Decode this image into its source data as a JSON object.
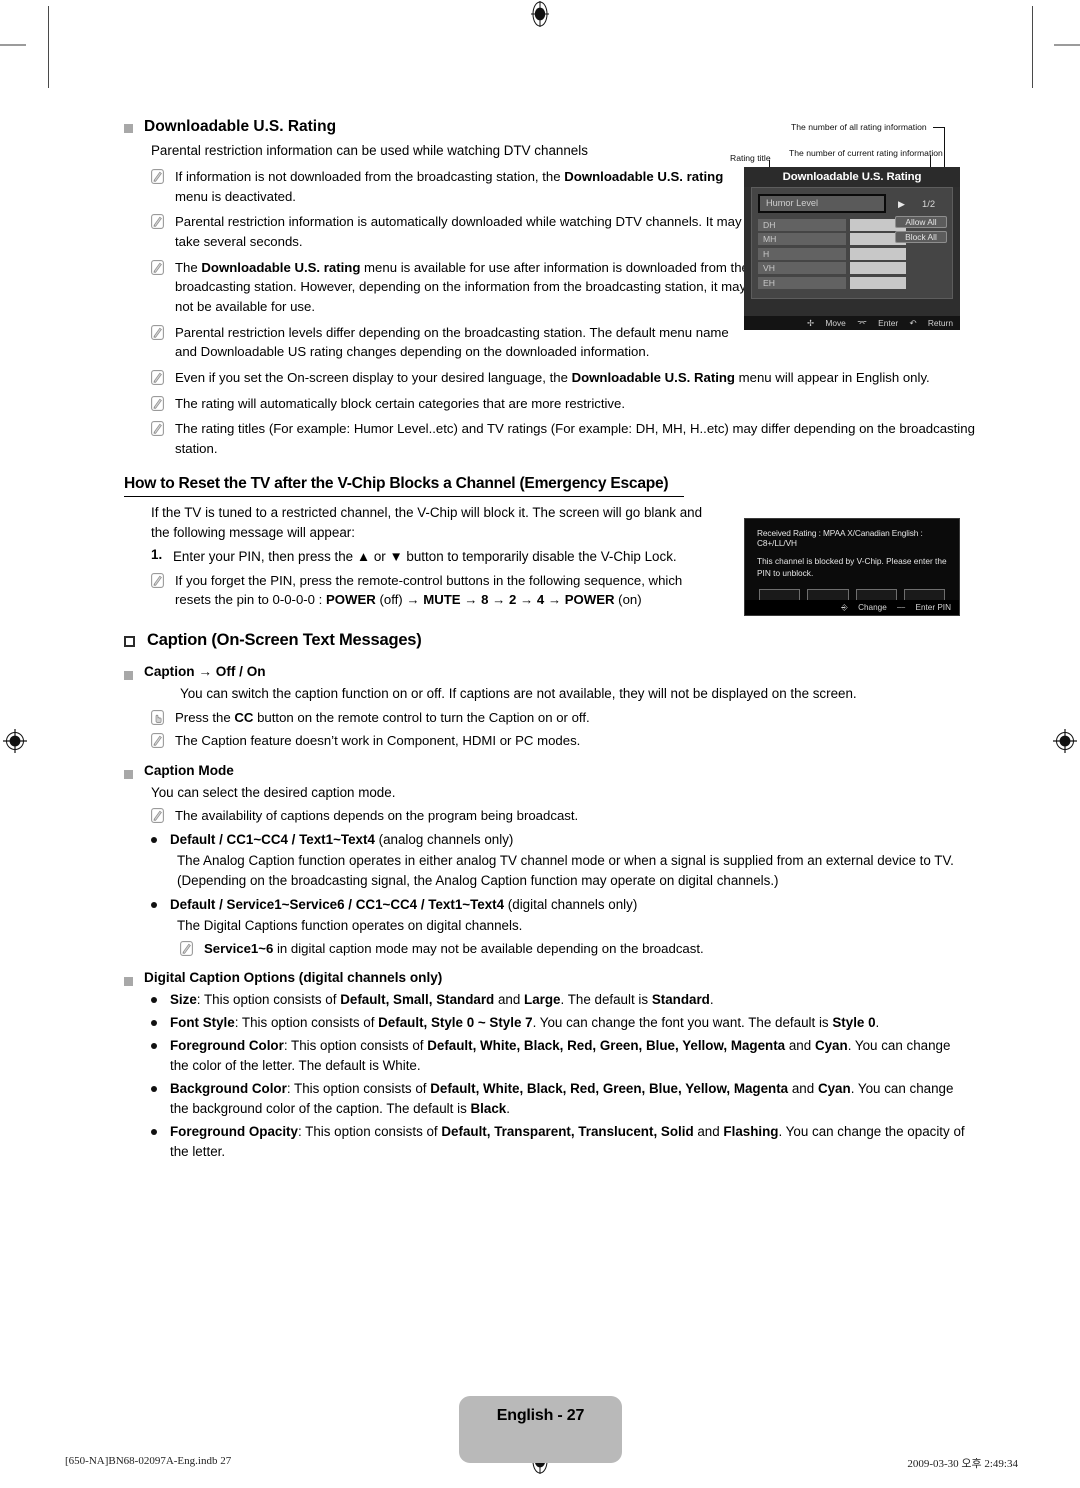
{
  "page": {
    "number_label": "English - 27",
    "footer_left": "[650-NA]BN68-02097A-Eng.indb   27",
    "footer_right": "2009-03-30   오후 2:49:34"
  },
  "sections": {
    "downloadable": {
      "heading": "Downloadable U.S. Rating",
      "intro": "Parental restriction information can be used while watching DTV channels",
      "notes": [
        "If information is not downloaded from the broadcasting station, the <b>Downloadable U.S. rating</b> menu is deactivated.",
        "Parental restriction information is automatically downloaded while watching DTV channels. It may take several seconds.",
        "The <b>Downloadable U.S. rating</b> menu is available for use after information is downloaded from the broadcasting station. However, depending on the information from the broadcasting station, it may not be available for use.",
        "Parental restriction levels differ depending on the broadcasting station. The default menu name and Downloadable US rating changes depending on the downloaded information.",
        "Even if you set the On-screen display to your desired language, the <b>Downloadable U.S. Rating</b> menu will appear in English only.",
        "The rating will automatically block certain categories that are more restrictive.",
        "The rating titles (For example: Humor Level..etc) and TV ratings (For example: DH, MH, H..etc) may differ depending on the broadcasting station."
      ]
    },
    "reset": {
      "heading": "How to Reset the TV after the V-Chip Blocks a Channel (Emergency Escape)",
      "intro": "If the TV is tuned to a restricted channel, the V-Chip will block it. The screen will go blank and the following message will appear:",
      "step_number": "1.",
      "step_text": "Enter your PIN, then press the ▲ or ▼ button to temporarily disable the V-Chip Lock.",
      "note": "If you forget the PIN, press the remote-control buttons in the following sequence, which resets the pin to 0-0-0-0 : <b>POWER</b> (off) → <b>MUTE</b> → <b>8</b> → <b>2</b> → <b>4</b> → <b>POWER</b> (on)"
    },
    "caption": {
      "heading": "Caption (On-Screen Text Messages)",
      "sub1": {
        "heading": "Caption → Off / On",
        "body": "You can switch the caption function on or off. If captions are not available, they will not be displayed on the screen.",
        "hand_note": "Press the <b>CC</b> button on the remote control to turn the Caption on or off.",
        "note": "The Caption feature doesn’t work in Component, HDMI or PC modes."
      },
      "sub2": {
        "heading": "Caption Mode",
        "body": "You can select the desired caption mode.",
        "note": "The availability of captions depends on the program being broadcast.",
        "bullets": [
          {
            "title": "<b>Default / CC1~CC4 / Text1~Text4</b> (analog channels only)",
            "body": "The Analog Caption function operates in either analog TV channel mode or when a signal is supplied from an external device to TV. (Depending on the broadcasting signal, the Analog Caption function may operate on digital channels.)"
          },
          {
            "title": "<b>Default / Service1~Service6 / CC1~CC4 / Text1~Text4</b> (digital channels only)",
            "body": "The Digital Captions function operates on digital channels.",
            "note": "<b>Service1~6</b> in digital caption mode may not be available depending on the broadcast."
          }
        ]
      },
      "sub3": {
        "heading": "Digital Caption Options (digital channels only)",
        "bullets": [
          "<b>Size</b>: This option consists of <b>Default, Small, Standard</b> and <b>Large</b>. The default is <b>Standard</b>.",
          "<b>Font Style</b>: This option consists of <b>Default, Style 0 ~ Style 7</b>. You can change the font you want. The default is <b>Style 0</b>.",
          "<b>Foreground Color</b>: This option consists of <b>Default, White, Black, Red, Green, Blue, Yellow, Magenta</b> and <b>Cyan</b>. You can change the color of the letter. The default is White.",
          "<b>Background Color</b>: This option consists of <b>Default, White, Black, Red, Green, Blue, Yellow, Magenta</b> and <b>Cyan</b>. You can change the background color of the caption. The default is <b>Black</b>.",
          "<b>Foreground Opacity</b>: This option consists of <b>Default, Transparent, Translucent, Solid</b> and <b>Flashing</b>. You can change the opacity of the letter."
        ]
      }
    }
  },
  "osd_rating": {
    "callout_all": "The number of all rating information",
    "callout_current": "The number of current rating information",
    "callout_title": "Rating title",
    "title": "Downloadable U.S. Rating",
    "selected_item": "Humor Level",
    "arrow": "▶",
    "page_indicator": "1/2",
    "rows": [
      "DH",
      "MH",
      "H",
      "VH",
      "EH"
    ],
    "buttons": [
      "Allow All",
      "Block All"
    ],
    "footer": [
      "Move",
      "Enter",
      "Return"
    ]
  },
  "osd_block": {
    "line1": "Received Rating : MPAA X/Canadian English : C8+/LL/VH",
    "line2": "This channel is blocked by V-Chip. Please enter the PIN to unblock.",
    "pin_boxes": 4,
    "footer": [
      "Change",
      "Enter PIN"
    ]
  },
  "colors": {
    "osd_bg": "#2e2e2e",
    "osd_panel": "#454545",
    "osd_bar": "#c8c8c8",
    "page_box": "#b9b9b9",
    "square_bullet": "#a8a8a8"
  }
}
